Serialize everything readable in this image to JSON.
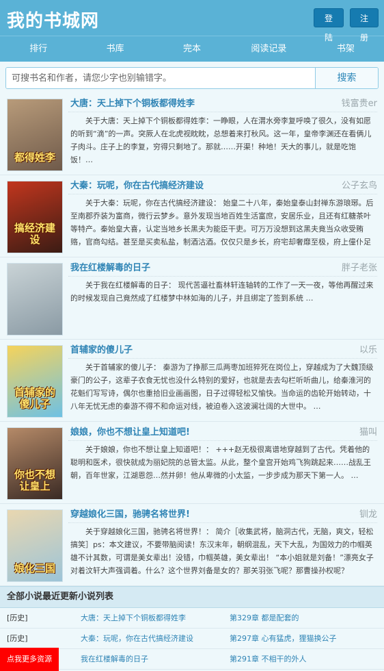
{
  "header": {
    "logo": "我的书城网",
    "login_label": "登陆",
    "register_label": "注册"
  },
  "nav": [
    "排行",
    "书库",
    "完本",
    "阅读记录",
    "书架"
  ],
  "search": {
    "placeholder": "可搜书名和作者，请您少字也别输错字。",
    "button_label": "搜索"
  },
  "books": [
    {
      "title": "大唐：天上掉下个铜板都得姓李",
      "author": "钱富贵er",
      "desc": "关于大唐：天上掉下个铜板都得姓李：一睁眼，人在渭水旁李复呼唤了很久，没有如愿的听到“滴”的一声。突厥人在北虎视眈眈，总想着来打秋风。这一年，皇帝李渊还在看俩儿子肉斗。庄子上的李复，穷得只剩地了。那就……开渠！种地！天大的事儿，就是吃饱饭！…",
      "cover_text": "都得姓李",
      "cover_colors": [
        "#6f5a4a",
        "#b89b7a"
      ]
    },
    {
      "title": "大秦：玩呢，你在古代搞经济建设",
      "author": "公子玄鸟",
      "desc": "关于大秦：玩呢，你在古代搞经济建设： 始皇二十八年，秦始皇泰山封禅东游琅琊。后至南郡乔装为富商，微行云梦乡。意外发现当地百姓生活富庶，安居乐业，且还有红糖茶叶等特产。秦始皇大喜，认定当地乡长黑夫为能臣干吏。可万万没想到这黑夫竟当众收受贿赂，官商勾结。甚至是买卖私盐，制酒沽酒。仅仅只是乡长，府宅却奢靡至极，府上僮仆足",
      "cover_text": "搞经济建设",
      "cover_colors": [
        "#3b1c14",
        "#c2361e"
      ]
    },
    {
      "title": "我在红楼解毒的日子",
      "author": "胖子老张",
      "desc": "关于我在红楼解毒的日子： 现代苦逼社畜林轩连轴转的工作了一天一夜，等他再醒过来的时候发现自己竟然成了红楼梦中林如海的儿子，并且绑定了签到系统 …",
      "cover_text": "",
      "cover_colors": [
        "#8a9aa4",
        "#c9d3d6"
      ]
    },
    {
      "title": "首辅家的傻儿子",
      "author": "以乐",
      "desc": "关于首辅家的傻儿子： 秦游为了挣那三瓜两枣加班猝死在岗位上，穿越成为了大魏顶级豪门的公子，这辈子衣食无忧也没什么特别的爱好，也就是去去勾栏听听曲儿，给秦淮河的花魁们写写诗，偶尔也重拾旧业画画图，日子过得轻松又愉快。当命运的齿轮开始转动，十八年无忧无虑的秦游不得不和命运对线，被迫卷入这波澜壮阔的大世中。 …",
      "cover_text": "首辅家的傻儿子",
      "cover_colors": [
        "#6ec1e4",
        "#f5d35b"
      ]
    },
    {
      "title": "娘娘，你也不想让皇上知道吧!",
      "author": "猫叫",
      "desc": "关于娘娘，你也不想让皇上知道吧！： +++赵无极很离谱地穿越到了古代。凭着他的聪明和医术，很快就成为丽妃院的总管太监。从此，整个皇宫开始鸡飞狗跳起来……战乱王朝，百年世家，江湖恩怨…然并卵！他从卑微的小太监，一步步成为那天下第一人。 …",
      "cover_text": "你也不想让皇上",
      "cover_colors": [
        "#3a2a24",
        "#b58a68"
      ]
    },
    {
      "title": "穿越娘化三国，驰骋名将世界!",
      "author": "钏龙",
      "desc": "关于穿越娘化三国，驰骋名将世界！： 简介［收集武将，脑洞古代，无脑，爽文，轻松搞笑］ps：本文建议，不要带脑阅读！东汉末年，朝纲混乱，天下大乱，为国效力的巾帼英雄不计其数，可谓是美女辈出！没错，巾帼英雄，美女辈出！ “本小姐就是刘备！”漂亮女子对着汶轩大声强调着。什么？这个世界刘备是女的？那关羽张飞呢？那曹操孙权呢？",
      "cover_text": "娘化三国",
      "cover_colors": [
        "#9cc4d8",
        "#e9d7b0"
      ]
    }
  ],
  "updates": {
    "heading": "全部小说最近更新小说列表",
    "rows": [
      {
        "category": "[历史]",
        "book": "大唐：天上掉下个铜板都得姓李",
        "chapter": "第329章 都是配套的"
      },
      {
        "category": "[历史]",
        "book": "大秦：玩呢，你在古代搞经济建设",
        "chapter": "第297章 心有猛虎，狸猫换公子"
      },
      {
        "category": "",
        "book": "我在红楼解毒的日子",
        "chapter": "第291章 不相干的外人"
      }
    ]
  },
  "floating_badge": "点我更多资源",
  "colors": {
    "primary": "#5ab2d6",
    "button": "#167bb0",
    "link": "#2f84b5",
    "badge": "#ff0000"
  }
}
